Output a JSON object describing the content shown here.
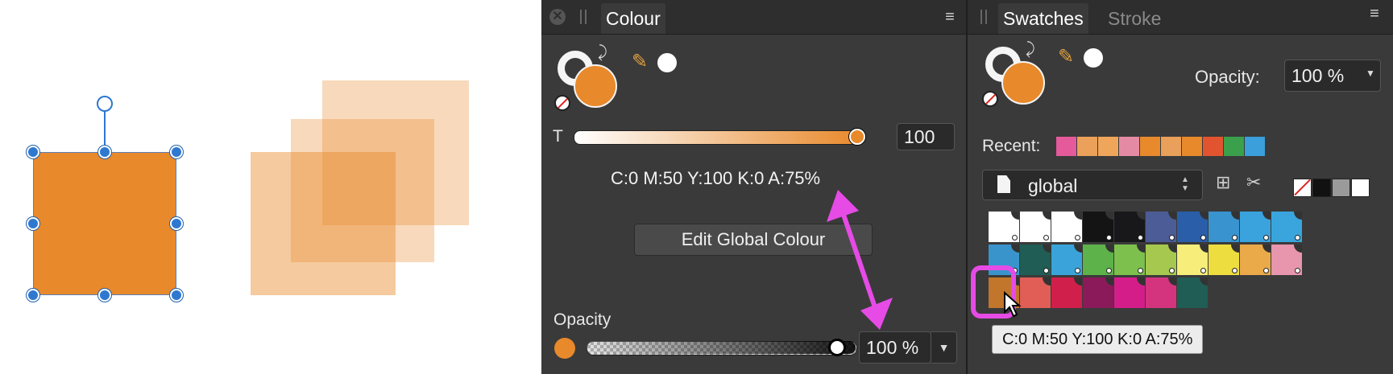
{
  "canvas": {
    "selected_fill": "#E8892B",
    "overlap_fill": "#F4C9A4"
  },
  "colour_panel": {
    "tab": "Colour",
    "t_label": "T",
    "t_value": "100",
    "colour_readout": "C:0 M:50 Y:100 K:0 A:75%",
    "edit_global_button": "Edit Global Colour",
    "opacity_label": "Opacity",
    "opacity_value": "100 %",
    "opacity_fraction": 1.0,
    "tint_fraction": 1.0,
    "fill_color": "#E8892B"
  },
  "swatches_panel": {
    "tabs": [
      "Swatches",
      "Stroke"
    ],
    "opacity_label": "Opacity:",
    "opacity_value": "100 %",
    "recent_label": "Recent:",
    "recent_colors": [
      "#E45A9A",
      "#EBA15A",
      "#F0A65A",
      "#E58AA5",
      "#E8892B",
      "#E9A05A",
      "#E8892B",
      "#E2542F",
      "#3AA04C",
      "#3A9FDB"
    ],
    "palette_name": "global",
    "basic_colors": [
      "none",
      "#111111",
      "#9a9a9a",
      "#ffffff"
    ],
    "grid_rows": [
      [
        "#FFFFFF",
        "#FFFFFF",
        "#FFFFFF",
        "#141414",
        "#18181B",
        "#4C5C96",
        "#2A5EA8",
        "#3993CE",
        "#3AA3DE",
        "#3AA5DD"
      ],
      [
        "#3A94CC",
        "#1F5D55",
        "#3AA4DA",
        "#5DB24A",
        "#7DC04D",
        "#A6C84E",
        "#F6ED7A",
        "#EEDD3E",
        "#EAAA4A",
        "#E895AE"
      ],
      [
        "#C2762C",
        "#E05E56",
        "#D11F4B",
        "#8A1A5A",
        "#D51D8A",
        "#D4347E",
        "#1F5D55"
      ]
    ],
    "tooltip": "C:0 M:50 Y:100 K:0 A:75%"
  },
  "annotation": {
    "color": "#E64BE6"
  }
}
